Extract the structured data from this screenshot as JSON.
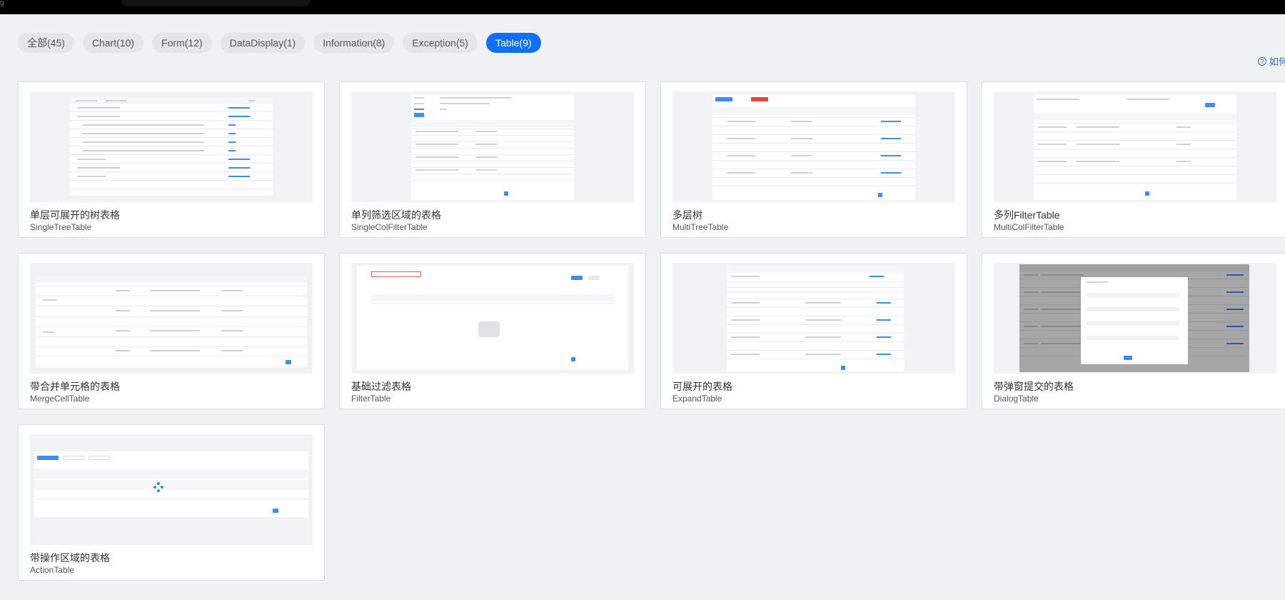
{
  "top_bar": {
    "edge_mark": "g"
  },
  "filters": [
    {
      "label": "全部(45)",
      "active": false
    },
    {
      "label": "Chart(10)",
      "active": false
    },
    {
      "label": "Form(12)",
      "active": false
    },
    {
      "label": "DataDisplay(1)",
      "active": false
    },
    {
      "label": "Information(8)",
      "active": false
    },
    {
      "label": "Exception(5)",
      "active": false
    },
    {
      "label": "Table(9)",
      "active": true
    }
  ],
  "help_link": {
    "label": "如何",
    "icon": "question-circle-icon"
  },
  "cards": [
    {
      "title": "单层可展开的树表格",
      "subtitle": "SingleTreeTable"
    },
    {
      "title": "单列筛选区域的表格",
      "subtitle": "SingleColFilterTable"
    },
    {
      "title": "多层树",
      "subtitle": "MultiTreeTable"
    },
    {
      "title": "多列FilterTable",
      "subtitle": "MultiColFilterTable"
    },
    {
      "title": "带合并单元格的表格",
      "subtitle": "MergeCellTable"
    },
    {
      "title": "基础过滤表格",
      "subtitle": "FilterTable"
    },
    {
      "title": "可展开的表格",
      "subtitle": "ExpandTable"
    },
    {
      "title": "带弹窗提交的表格",
      "subtitle": "DialogTable"
    },
    {
      "title": "带操作区域的表格",
      "subtitle": "ActionTable"
    }
  ],
  "colors": {
    "accent": "#0e6ffb",
    "link": "#2b6fe0",
    "page_bg": "#f0f1f3"
  }
}
